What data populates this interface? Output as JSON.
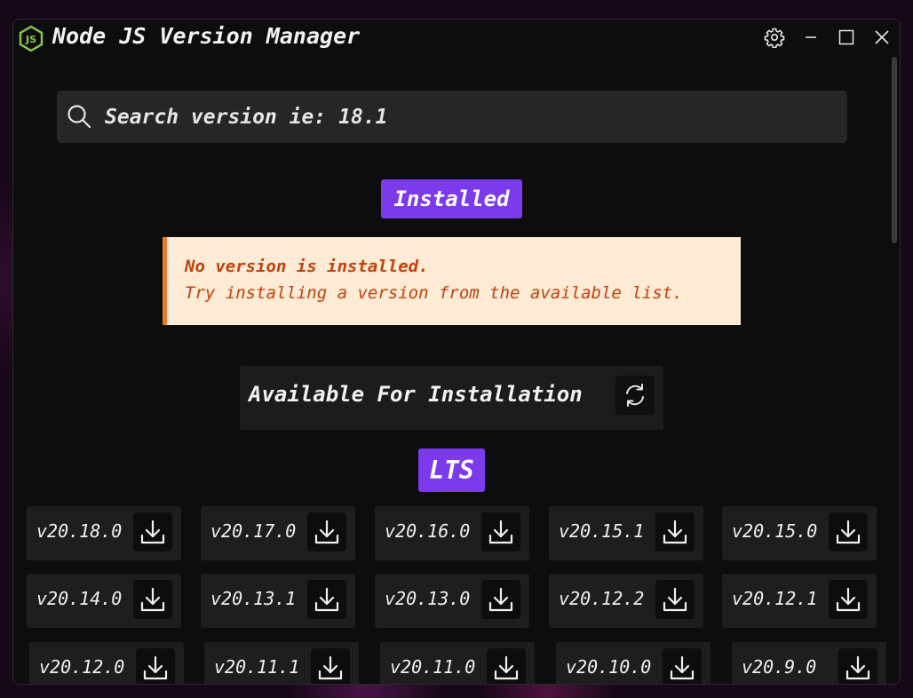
{
  "window": {
    "title": "Node JS Version Manager",
    "app_icon_text": "JS"
  },
  "search": {
    "placeholder": "Search version ie: 18.1"
  },
  "installed": {
    "heading": "Installed",
    "alert_title": "No version is installed.",
    "alert_body": "Try installing a version from the available list."
  },
  "available": {
    "heading": "Available For Installation"
  },
  "lts": {
    "heading": "LTS",
    "versions": [
      "v20.18.0",
      "v20.17.0",
      "v20.16.0",
      "v20.15.1",
      "v20.15.0",
      "v20.14.0",
      "v20.13.1",
      "v20.13.0",
      "v20.12.2",
      "v20.12.1",
      "v20.12.0",
      "v20.11.1",
      "v20.11.0",
      "v20.10.0",
      "v20.9.0"
    ]
  },
  "colors": {
    "accent": "#7c3aed",
    "alert_bg": "#feebd5",
    "alert_border": "#f0782a",
    "alert_text": "#c2410c",
    "node_green": "#8cc84b"
  },
  "icons": {
    "app": "nodejs-logo-icon",
    "settings": "gear-icon",
    "minimize": "minimize-icon",
    "maximize": "maximize-icon",
    "close": "close-icon",
    "search": "search-icon",
    "refresh": "refresh-icon",
    "download": "download-icon"
  }
}
